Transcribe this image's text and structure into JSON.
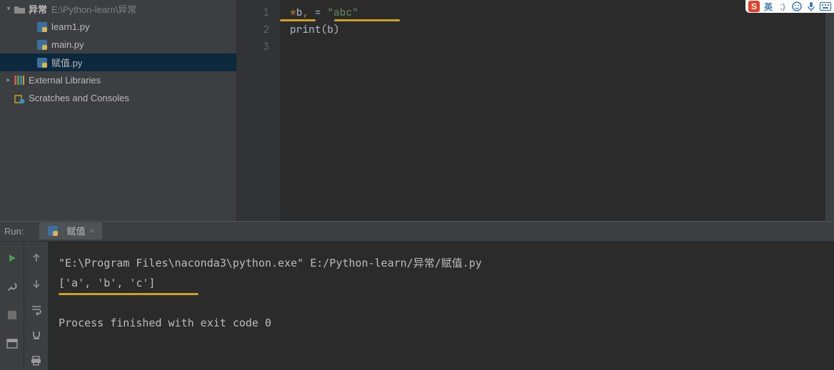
{
  "project": {
    "root_label": "异常",
    "root_path": "E:\\Python-learn\\异常",
    "files": [
      "learn1.py",
      "main.py",
      "赋值.py"
    ],
    "selected_index": 2,
    "external_label": "External Libraries",
    "scratches_label": "Scratches and Consoles"
  },
  "editor": {
    "line_numbers": [
      "1",
      "2",
      "3"
    ],
    "line1_star": "*",
    "line1_var": "b",
    "line1_com": ",",
    "line1_eq": " = ",
    "line1_str": "\"abc\"",
    "line2_fn": "print",
    "line2_lp": "(",
    "line2_arg": "b",
    "line2_rp": ")"
  },
  "run": {
    "title": "Run:",
    "tab_label": "赋值",
    "output_cmd": "\"E:\\Program Files\\naconda3\\python.exe\" E:/Python-learn/异常/赋值.py",
    "output_list": "['a', 'b', 'c']",
    "output_exit": "Process finished with exit code 0"
  },
  "ime": {
    "sogou": "S",
    "lang": "英",
    "sep": ";)"
  }
}
